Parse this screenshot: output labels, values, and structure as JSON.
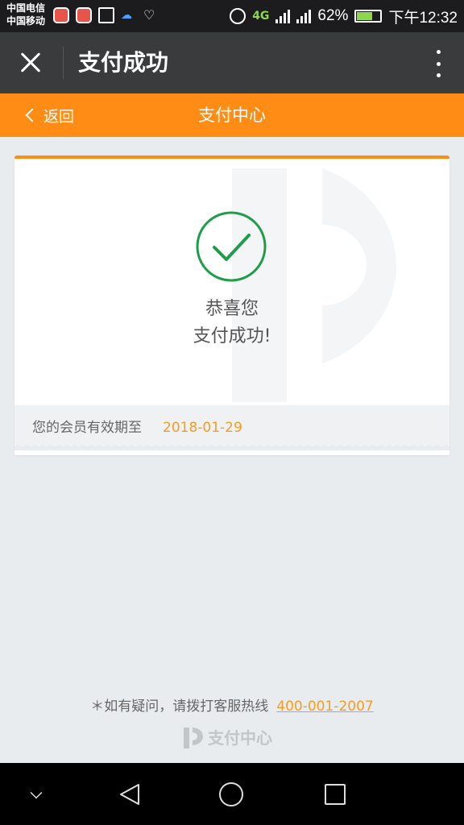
{
  "status_bar": {
    "carrier1": "中国电信",
    "carrier2": "中国移动",
    "network": "4G",
    "battery": "62%",
    "time": "下午12:32",
    "icons": [
      "app-icon",
      "app-icon",
      "image-icon",
      "cloud-icon",
      "heart-icon",
      "alarm-icon",
      "signal-icon",
      "battery-icon"
    ]
  },
  "app_bar": {
    "title": "支付成功"
  },
  "nav": {
    "back_label": "返回",
    "title": "支付中心"
  },
  "card": {
    "line1": "恭喜您",
    "line2": "支付成功!",
    "member_label": "您的会员有效期至",
    "member_date": "2018-01-29"
  },
  "footer": {
    "help_text": "＊如有疑问，请拨打客服热线",
    "hotline": "400-001-2007",
    "brand": "支付中心"
  },
  "colors": {
    "accent": "#ff8c14",
    "success": "#1e9e4a",
    "app_bar": "#3a3b3d",
    "background": "#e9ecef"
  }
}
